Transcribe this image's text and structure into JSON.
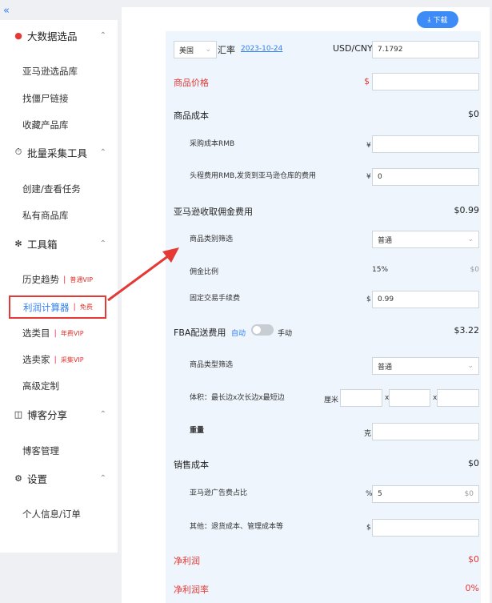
{
  "sidebar": {
    "collapse_glyph": "«",
    "sections": [
      {
        "title": "大数据选品",
        "icon": "location-pin-icon"
      },
      {
        "title": "批量采集工具",
        "icon": "timer-icon"
      },
      {
        "title": "工具箱",
        "icon": "sparkle-icon"
      },
      {
        "title": "博客分享",
        "icon": "book-icon"
      },
      {
        "title": "设置",
        "icon": "gear-icon"
      }
    ],
    "items": {
      "amazon_library": "亚马逊选品库",
      "find_links": "找僵尸链接",
      "favorites": "收藏产品库",
      "create_task": "创建/查看任务",
      "private_library": "私有商品库",
      "history": "历史趋势",
      "history_tag": "普通VIP",
      "profit_calc": "利润计算器",
      "profit_tag": "免费",
      "category": "选类目",
      "category_tag": "年费VIP",
      "seller": "选卖家",
      "seller_tag": "采集VIP",
      "custom": "高级定制",
      "blog_manage": "博客管理",
      "profile": "个人信息/订单"
    }
  },
  "toolbar": {
    "download_label": "下载",
    "download_icon": "download-icon"
  },
  "calc": {
    "country": "美国",
    "rate_label": "汇率",
    "rate_date": "2023-10-24",
    "currency_pair": "USD/CNY",
    "rate_value": "7.1792",
    "price_label": "商品价格",
    "price_symbol": "$",
    "cost_label": "商品成本",
    "cost_amount": "$0",
    "purchase_label": "采购成本RMB",
    "purchase_symbol": "¥",
    "shipping_label": "头程费用RMB,发货到亚马逊仓库的费用",
    "shipping_symbol": "¥",
    "shipping_value": "0",
    "commission_label": "亚马逊收取佣金费用",
    "commission_amount": "$0.99",
    "category_filter_label": "商品类别筛选",
    "category_filter_value": "普通",
    "commission_rate_label": "佣金比例",
    "commission_rate_value": "15%",
    "commission_rate_amount": "$0",
    "fixed_fee_label": "固定交易手续费",
    "fixed_fee_symbol": "$",
    "fixed_fee_value": "0.99",
    "fba_label": "FBA配送费用",
    "fba_auto": "自动",
    "fba_manual": "手动",
    "fba_amount": "$3.22",
    "fba_category_label": "商品类型筛选",
    "fba_category_value": "普通",
    "volume_label": "体积：最长边x次长边x最短边",
    "volume_unit": "厘米",
    "volume_x1": "x",
    "volume_x2": "x",
    "weight_label": "重量",
    "weight_unit": "克",
    "sales_cost_label": "销售成本",
    "sales_cost_amount": "$0",
    "ad_label": "亚马逊广告费占比",
    "ad_symbol": "%",
    "ad_value": "5",
    "ad_amount": "$0",
    "other_label": "其他：退货成本、管理成本等",
    "other_symbol": "$",
    "net_profit_label": "净利润",
    "net_profit_amount": "$0",
    "net_margin_label": "净利润率",
    "net_margin_amount": "0%"
  }
}
